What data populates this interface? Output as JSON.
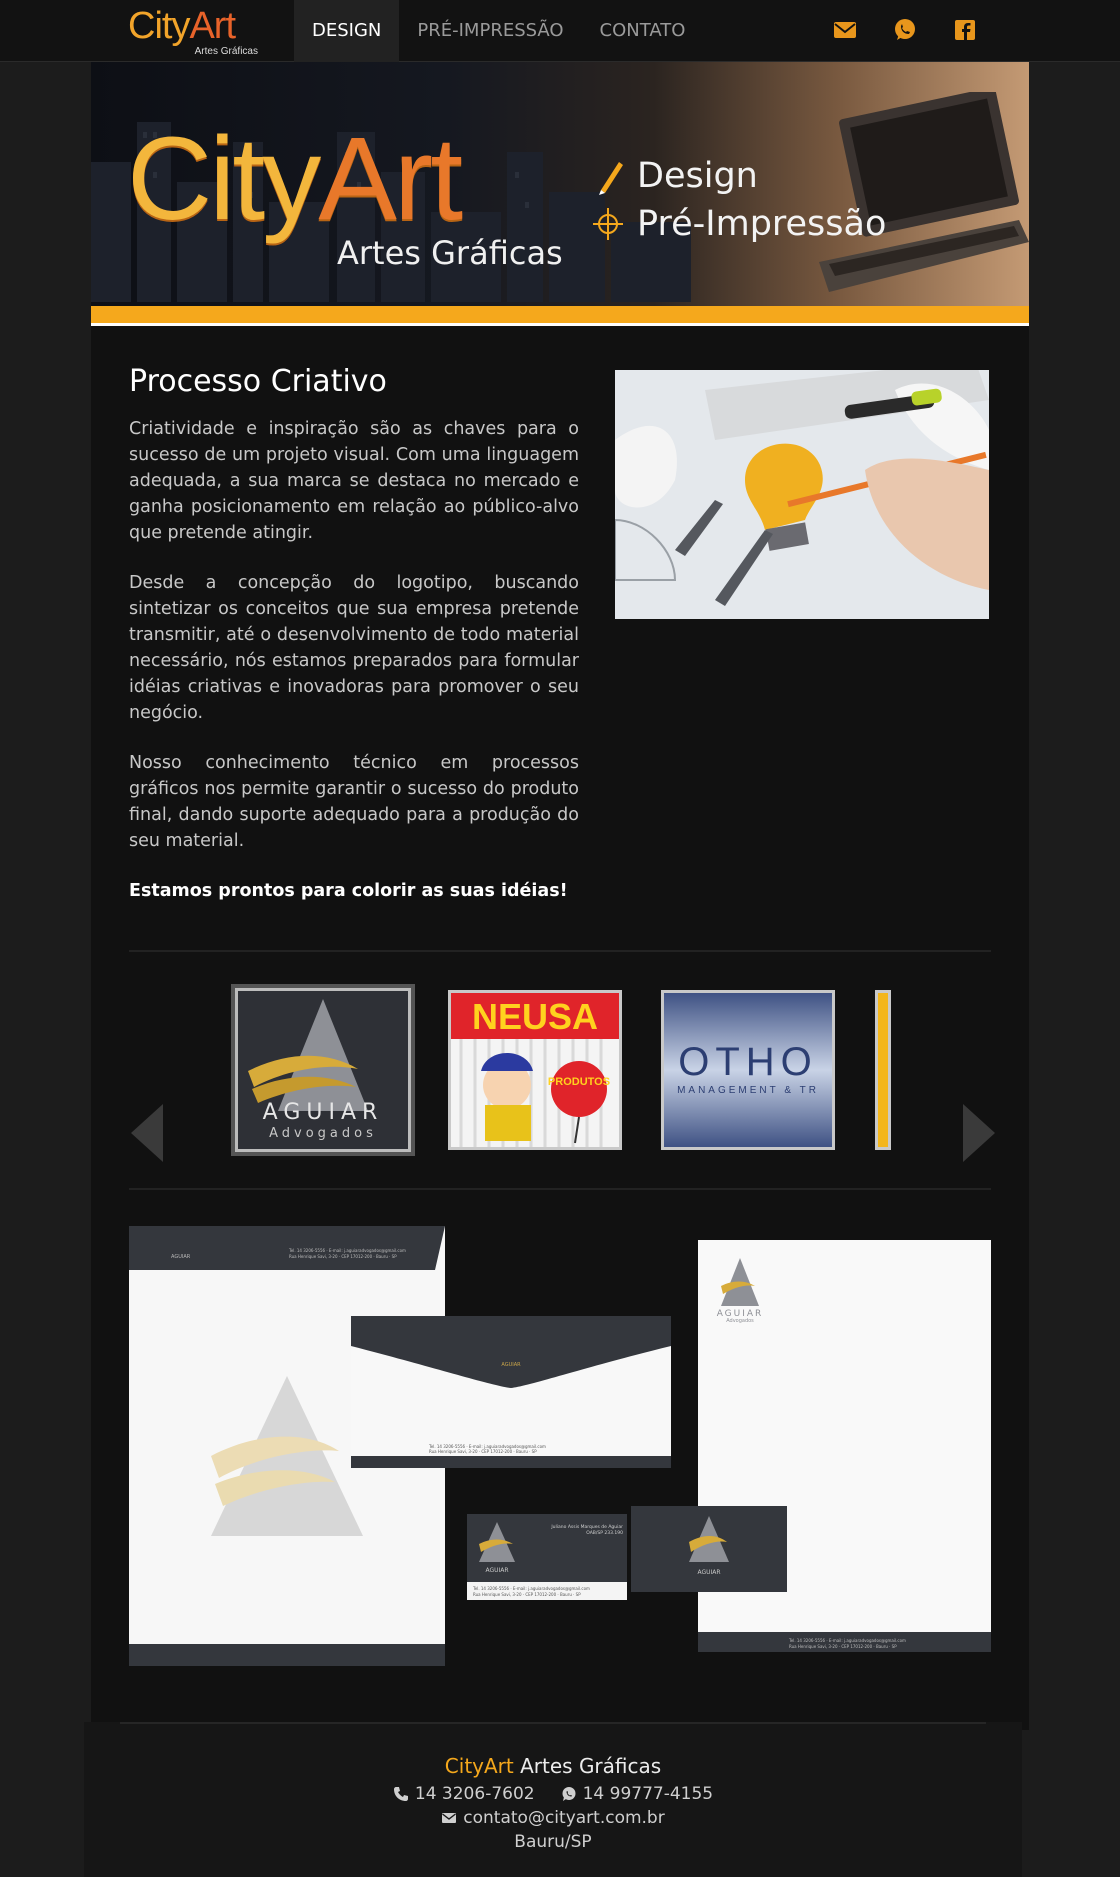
{
  "nav": {
    "logo_brand_pre": "City",
    "logo_brand_post": "Art",
    "logo_tagline": "Artes Gráficas",
    "links": [
      {
        "label": "DESIGN",
        "active": true
      },
      {
        "label": "PRÉ-IMPRESSÃO",
        "active": false
      },
      {
        "label": "CONTATO",
        "active": false
      }
    ],
    "icons": [
      "envelope-icon",
      "whatsapp-icon",
      "facebook-icon"
    ],
    "icon_color": "#f5a81c"
  },
  "banner": {
    "brand_pre": "City",
    "brand_post": "Art",
    "subtitle": "Artes Gráficas",
    "services": [
      "Design",
      "Pré-Impressão"
    ],
    "stripe_color": "#f5a81c"
  },
  "content": {
    "title": "Processo Criativo",
    "paragraphs": [
      "Criatividade e inspiração são as chaves para o sucesso de um projeto visual. Com uma linguagem adequada, a sua marca se destaca no mercado e ganha posicionamento em relação ao público-alvo que pretende atingir.",
      "Desde a concepção do logotipo, buscando sintetizar os conceitos que sua empresa pretende transmitir, até o desenvolvimento de todo material necessário, nós estamos preparados para formular idéias criativas e inovadoras para promover o seu negócio.",
      "Nosso conhecimento técnico em processos gráficos nos permite garantir o sucesso do produto final, dando suporte adequado para a produção do seu material."
    ],
    "lead": "Estamos prontos para colorir as suas idéias!"
  },
  "carousel": {
    "items": [
      {
        "name": "aguiar-logo",
        "line1": "AGUIAR",
        "line2": "Advogados"
      },
      {
        "name": "neusa-logo",
        "line1": "NEUSA",
        "line2": "PRODUTOS"
      },
      {
        "name": "otho-logo",
        "line1": "OTHO",
        "line2": "MANAGEMENT & TR"
      }
    ]
  },
  "mockup": {
    "brand": "AGUIAR",
    "brand_sub": "Advogados",
    "contact_line1": "Tel. 14 3206-5556 · E-mail: j.aguiaradvogados@gmail.com",
    "contact_line2": "Rua Henrique Savi, 3-20 · CEP 17012-200 · Bauru · SP",
    "card_name": "Juliano Assis Marques de Aguiar",
    "card_oab": "OAB/SP 233.190"
  },
  "footer": {
    "brand_pre": "CityArt",
    "brand_post": "Artes Gráficas",
    "phone": "14 3206-7602",
    "whatsapp": "14 99777-4155",
    "email": "contato@cityart.com.br",
    "city": "Bauru/SP"
  }
}
